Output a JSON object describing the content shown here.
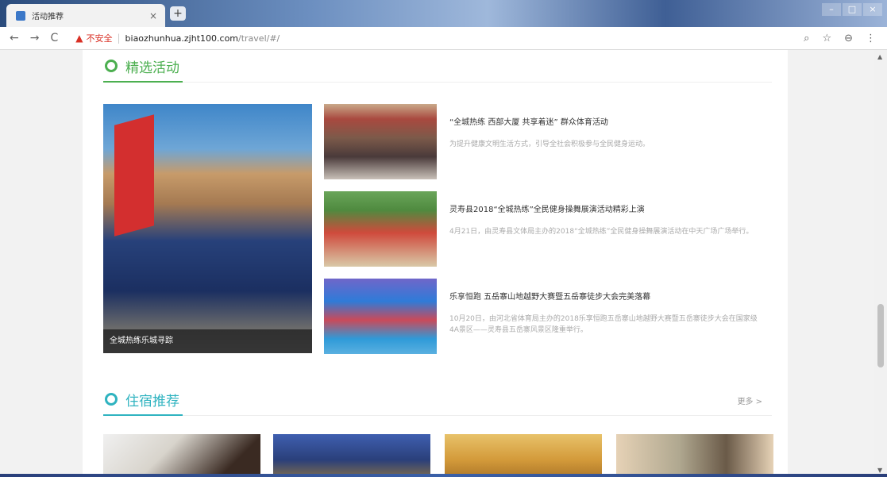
{
  "browser": {
    "tab_title": "活动推荐",
    "tab_close": "×",
    "new_tab": "+",
    "window_controls": [
      "–",
      "□",
      "×"
    ],
    "nav": {
      "back": "←",
      "forward": "→",
      "reload": "C"
    },
    "security_icon": "warning-triangle-icon",
    "not_secure": "不安全",
    "url_host": "biaozhunhua.zjht100.com",
    "url_path": "/travel/#/",
    "icons": [
      "zoom-icon",
      "star-icon",
      "account-icon",
      "menu-icon"
    ],
    "icon_glyphs": [
      "⌕",
      "☆",
      "⊖",
      "⋮"
    ]
  },
  "sections": {
    "activities": {
      "title": "精选活动",
      "ring_color": "#4caf50"
    },
    "lodging": {
      "title": "住宿推荐",
      "ring_color": "#2fb3c0",
      "more": "更多 >"
    }
  },
  "featured": {
    "caption": "全城热练乐城寻踪"
  },
  "items": [
    {
      "title": "“全城热练 西部大厦 共享着迷” 群众体育活动",
      "desc": "为提升健康文明生活方式，引导全社会积极参与全民健身运动。"
    },
    {
      "title": "灵寿县2018“全城热练”全民健身操舞展演活动精彩上演",
      "desc": "4月21日，由灵寿县文体局主办的2018“全城热练”全民健身操舞展演活动在中天广场广场举行。"
    },
    {
      "title": "乐享恒跑 五岳寨山地越野大赛暨五岳寨徒步大会完美落幕",
      "desc": "10月20日，由河北省体育局主办的2018乐享恒跑五岳寨山地越野大赛暨五岳寨徒步大会在国家级4A景区——灵寿县五岳寨风景区隆重举行。"
    }
  ]
}
